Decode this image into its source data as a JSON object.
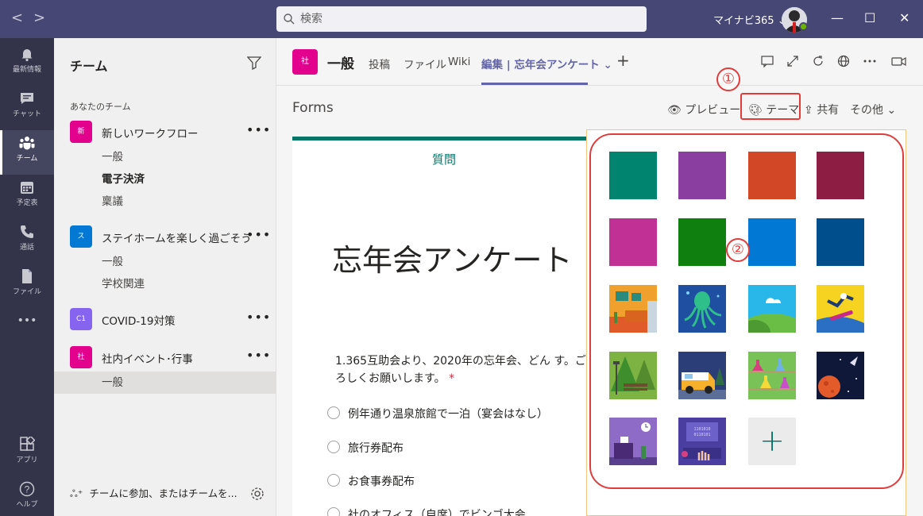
{
  "titlebar": {
    "back": "<",
    "forward": ">",
    "search_placeholder": "検索",
    "tenant": "マイナビ365",
    "tenant_chevron": "⌄",
    "minimize": "—",
    "maximize": "☐",
    "close": "✕"
  },
  "rail": [
    {
      "label": "最新情報",
      "icon": "bell-icon"
    },
    {
      "label": "チャット",
      "icon": "chat-icon"
    },
    {
      "label": "チーム",
      "icon": "teams-icon"
    },
    {
      "label": "予定表",
      "icon": "calendar-icon"
    },
    {
      "label": "通話",
      "icon": "phone-icon"
    },
    {
      "label": "ファイル",
      "icon": "file-icon"
    },
    {
      "label": "•••",
      "icon": "more-icon"
    },
    {
      "label": "アプリ",
      "icon": "apps-icon"
    },
    {
      "label": "ヘルプ",
      "icon": "help-icon"
    }
  ],
  "teams_panel": {
    "title": "チーム",
    "section_label": "あなたのチーム",
    "more": "•••",
    "teams": [
      {
        "name": "新しいワークフロー",
        "avatar": "新",
        "color": "#e3008c",
        "channels": [
          "一般",
          "電子決済",
          "稟議"
        ]
      },
      {
        "name": "ステイホームを楽しく過ごそう",
        "avatar": "ス",
        "color": "#0078d4",
        "channels": [
          "一般",
          "学校関連"
        ]
      },
      {
        "name": "COVID-19対策",
        "avatar": "C1",
        "color": "#8764f0",
        "channels": []
      },
      {
        "name": "社内イベント･行事",
        "avatar": "社",
        "color": "#e3008c",
        "channels": [
          "一般"
        ]
      }
    ],
    "join_text": "チームに参加、またはチームを..."
  },
  "channel_header": {
    "avatar": "社",
    "title": "一般",
    "tabs": [
      "投稿",
      "ファイル",
      "Wiki",
      "編集 | 忘年会アンケート"
    ],
    "tab_chevron": "⌄",
    "add_tab": "+"
  },
  "forms_toolbar": {
    "app_name": "Forms",
    "preview": "プレビュー",
    "theme": "テーマ",
    "share": "共有",
    "more": "その他"
  },
  "annotations": {
    "one": "①",
    "two": "②"
  },
  "form": {
    "tab": "質問",
    "title": "忘年会アンケート",
    "question": "1.365互助会より、2020年の忘年会、どん す。ご協力よろしくお願いします。",
    "required_mark": "*",
    "options": [
      "例年通り温泉旅館で一泊（宴会はなし）",
      "旅行券配布",
      "お食事券配布",
      "社のオフィス（自席）でビンゴ大会"
    ]
  },
  "themes": {
    "solid_colors": [
      "#00836f",
      "#8a3e9f",
      "#d24726",
      "#8e1d44",
      "#c03095",
      "#0f7f0f",
      "#0078d4",
      "#004e8c"
    ],
    "pictures": [
      "living-room-theme",
      "octopus-theme",
      "sky-hill-theme",
      "snowboard-theme",
      "park-bench-theme",
      "camper-van-theme",
      "lab-flasks-theme",
      "space-theme",
      "office-desk-theme",
      "computer-keyboard-theme"
    ],
    "add_label": "+"
  }
}
